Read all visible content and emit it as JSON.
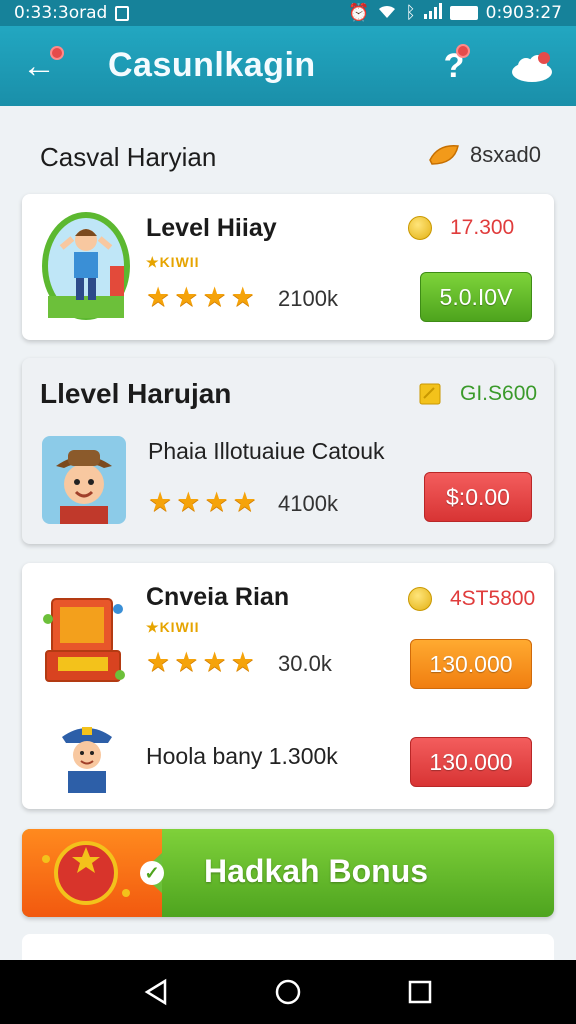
{
  "status_bar": {
    "left_text": "0:33:3orad",
    "time": "0:903:27"
  },
  "app_bar": {
    "title": "Casunlkagin"
  },
  "section": {
    "title": "Casval Haryian",
    "score": "8sxad0"
  },
  "cards": [
    {
      "title": "Level Hiiay",
      "tag": "KIWII",
      "rating_count": "2100k",
      "reward_value": "17.300",
      "button_label": "5.0.I0V",
      "button_color": "#5cb82a"
    },
    {
      "title": "Llevel Harujan",
      "subtitle": "Phaia Illotuaiue Catouk",
      "rating_count": "4100k",
      "reward_value": "GI.S600",
      "button_label": "$:0.00",
      "button_color": "#e03c3c"
    },
    {
      "title": "Cnveia Rian",
      "tag": "KIWII",
      "rating_count": "30.0k",
      "reward_value": "4ST5800",
      "button_label": "130.000",
      "button_color": "#f58b18",
      "second_row": {
        "label": "Hoola bany 1.300k",
        "button_label": "130.000",
        "button_color": "#e03c3c"
      }
    }
  ],
  "bonus": {
    "label": "Hadkah Bonus"
  },
  "colors": {
    "appbar": "#1a8fa9",
    "accent_green": "#5cb82a",
    "accent_red": "#e03c3c",
    "accent_orange": "#f58b18",
    "star": "#f5a30a"
  }
}
